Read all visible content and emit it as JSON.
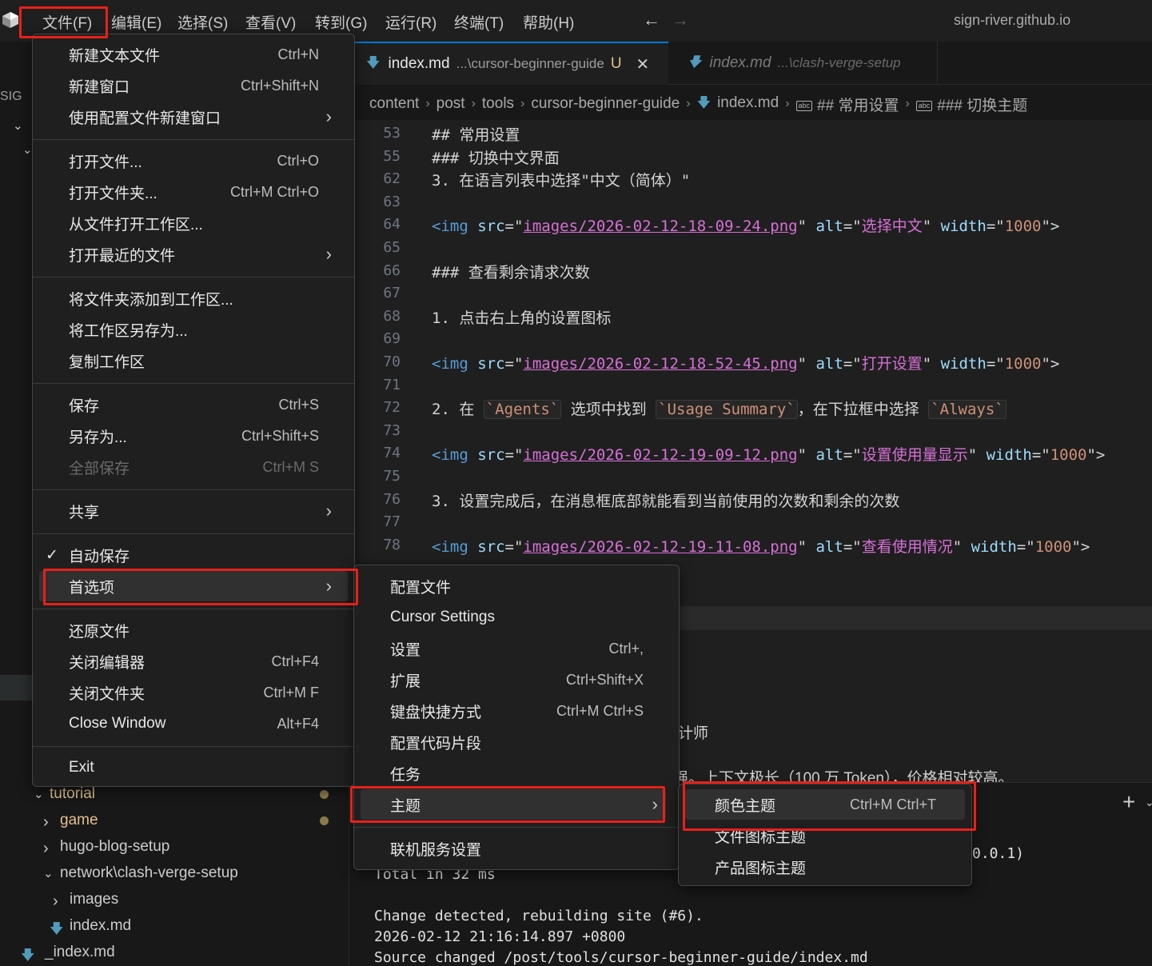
{
  "menubar": {
    "items": [
      "文件(F)",
      "编辑(E)",
      "选择(S)",
      "查看(V)",
      "转到(G)",
      "运行(R)",
      "终端(T)",
      "帮助(H)"
    ],
    "window_title": "sign-river.github.io"
  },
  "sidebar": {
    "header_fragment": "SIG",
    "tree": [
      {
        "label": "tutorial",
        "modified": true
      },
      {
        "label": "game",
        "modified": true
      },
      {
        "label": "hugo-blog-setup",
        "modified": false
      },
      {
        "label": "network\\clash-verge-setup",
        "modified": false
      },
      {
        "label": "images",
        "modified": false
      },
      {
        "label": "index.md",
        "modified": false
      },
      {
        "label": "_index.md",
        "modified": false
      }
    ]
  },
  "tabs": [
    {
      "name": "index.md",
      "path": "...\\cursor-beginner-guide",
      "status": "U",
      "active": true
    },
    {
      "name": "index.md",
      "path": "...\\clash-verge-setup",
      "active": false
    }
  ],
  "breadcrumb": [
    "content",
    "post",
    "tools",
    "cursor-beginner-guide",
    "index.md",
    "## 常用设置",
    "### 切换主题"
  ],
  "code_lines": [
    {
      "n": "53",
      "text": "## 常用设置"
    },
    {
      "n": "55",
      "text": "### 切换中文界面"
    },
    {
      "n": "62",
      "text": "3. 在语言列表中选择\"中文（简体）\""
    },
    {
      "n": "63",
      "text": ""
    },
    {
      "n": "64",
      "img": {
        "src": "images/2026-02-12-18-09-24.png",
        "alt": "选择中文",
        "width": "1000"
      }
    },
    {
      "n": "65",
      "text": ""
    },
    {
      "n": "66",
      "text": "### 查看剩余请求次数"
    },
    {
      "n": "67",
      "text": ""
    },
    {
      "n": "68",
      "text": "1. 点击右上角的设置图标"
    },
    {
      "n": "69",
      "text": ""
    },
    {
      "n": "70",
      "img": {
        "src": "images/2026-02-12-18-52-45.png",
        "alt": "打开设置",
        "width": "1000"
      }
    },
    {
      "n": "71",
      "text": ""
    },
    {
      "n": "72",
      "parts": [
        "2. 在 ",
        "`Agents`",
        " 选项中找到 ",
        "`Usage Summary`",
        "，在下拉框中选择 ",
        "`Always`"
      ]
    },
    {
      "n": "73",
      "text": ""
    },
    {
      "n": "74",
      "img": {
        "src": "images/2026-02-12-19-09-12.png",
        "alt": "设置使用量显示",
        "width": "1000"
      }
    },
    {
      "n": "75",
      "text": ""
    },
    {
      "n": "76",
      "text": "3. 设置完成后，在消息框底部就能看到当前使用的次数和剩余的次数"
    },
    {
      "n": "77",
      "text": ""
    },
    {
      "n": "78",
      "img": {
        "src": "images/2026-02-12-19-11-08.png",
        "alt": "查看使用情况",
        "width": "1000"
      }
    }
  ],
  "editor_fragments": {
    "line_a": "计师",
    "line_b": "强。上下文极长（100 万 Token），价格相对较高。"
  },
  "terminal": {
    "fragment": "0.0.1)",
    "plus": "+",
    "lines": [
      "Total in 32 ms",
      "",
      "Change detected, rebuilding site (#6).",
      "2026-02-12 21:16:14.897 +0800",
      "Source changed /post/tools/cursor-beginner-guide/index.md"
    ]
  },
  "file_menu": {
    "groups": [
      [
        {
          "label": "新建文本文件",
          "key": "Ctrl+N"
        },
        {
          "label": "新建窗口",
          "key": "Ctrl+Shift+N"
        },
        {
          "label": "使用配置文件新建窗口",
          "submenu": true
        }
      ],
      [
        {
          "label": "打开文件...",
          "key": "Ctrl+O"
        },
        {
          "label": "打开文件夹...",
          "key": "Ctrl+M Ctrl+O"
        },
        {
          "label": "从文件打开工作区..."
        },
        {
          "label": "打开最近的文件",
          "submenu": true
        }
      ],
      [
        {
          "label": "将文件夹添加到工作区..."
        },
        {
          "label": "将工作区另存为..."
        },
        {
          "label": "复制工作区"
        }
      ],
      [
        {
          "label": "保存",
          "key": "Ctrl+S"
        },
        {
          "label": "另存为...",
          "key": "Ctrl+Shift+S"
        },
        {
          "label": "全部保存",
          "key": "Ctrl+M S",
          "disabled": true
        }
      ],
      [
        {
          "label": "共享",
          "submenu": true
        }
      ],
      [
        {
          "label": "自动保存",
          "checked": true
        },
        {
          "label": "首选项",
          "submenu": true,
          "highlighted": true
        }
      ],
      [
        {
          "label": "还原文件"
        },
        {
          "label": "关闭编辑器",
          "key": "Ctrl+F4"
        },
        {
          "label": "关闭文件夹",
          "key": "Ctrl+M F"
        },
        {
          "label": "Close Window",
          "key": "Alt+F4"
        }
      ],
      [
        {
          "label": "Exit"
        }
      ]
    ]
  },
  "preferences_menu": {
    "groups": [
      [
        {
          "label": "配置文件"
        },
        {
          "label": "Cursor Settings"
        },
        {
          "label": "设置",
          "key": "Ctrl+,"
        },
        {
          "label": "扩展",
          "key": "Ctrl+Shift+X"
        },
        {
          "label": "键盘快捷方式",
          "key": "Ctrl+M Ctrl+S"
        },
        {
          "label": "配置代码片段"
        },
        {
          "label": "任务"
        },
        {
          "label": "主题",
          "submenu": true,
          "highlighted": true
        }
      ],
      [
        {
          "label": "联机服务设置"
        }
      ]
    ]
  },
  "theme_menu": {
    "items": [
      {
        "label": "颜色主题",
        "key": "Ctrl+M Ctrl+T",
        "highlighted": true
      },
      {
        "label": "文件图标主题"
      },
      {
        "label": "产品图标主题"
      }
    ]
  },
  "colors": {
    "accent": "#0078d4",
    "highlight_box": "#e8201a",
    "link": "#d670d6",
    "git_modified": "#e2c08d"
  }
}
